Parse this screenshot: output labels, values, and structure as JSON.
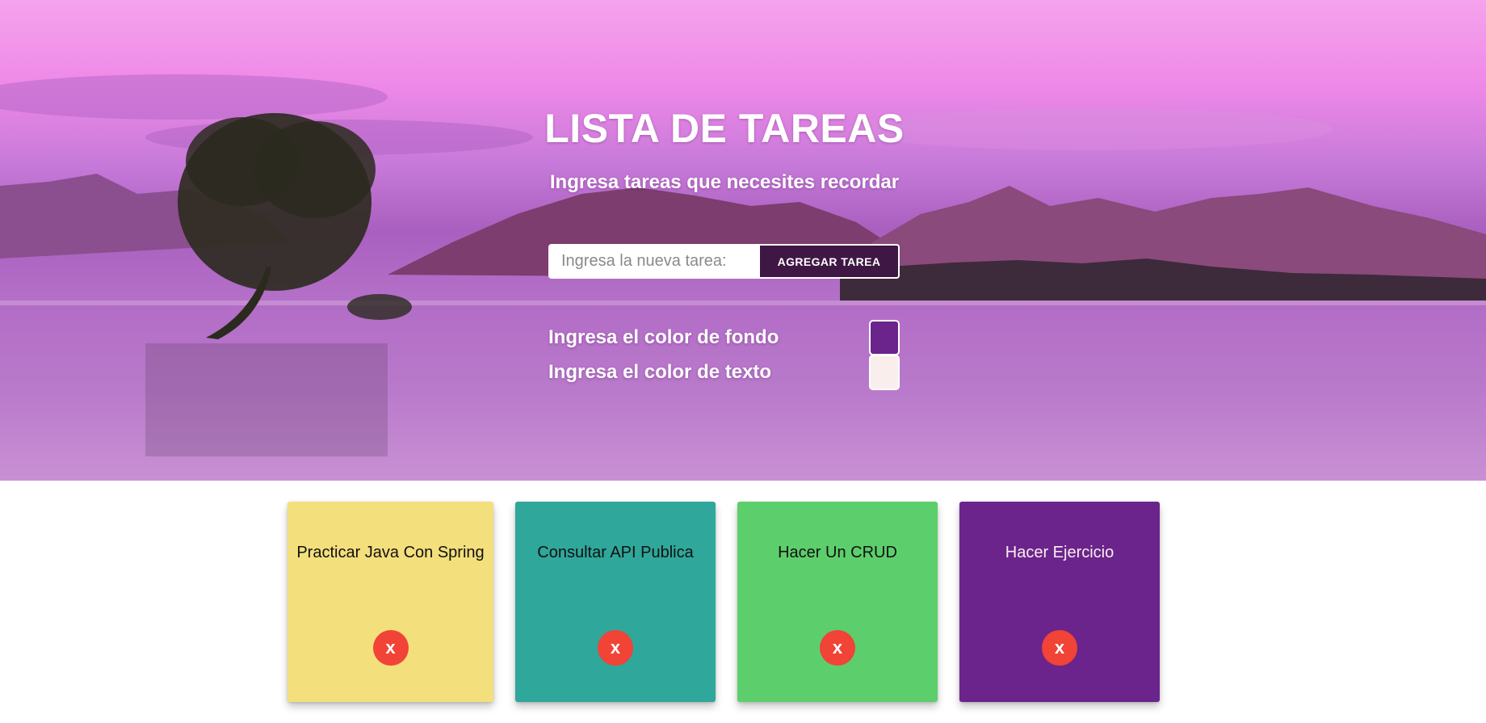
{
  "header": {
    "title": "LISTA DE TAREAS",
    "subtitle": "Ingresa tareas que necesites recordar"
  },
  "form": {
    "task_placeholder": "Ingresa la nueva tarea:",
    "task_value": "",
    "add_label": "AGREGAR TAREA"
  },
  "colors": {
    "background_label": "Ingresa el color de fondo",
    "background_value": "#6b248c",
    "text_label": "Ingresa el color de texto",
    "text_value": "#faeeec",
    "accent_button": "#3f1744",
    "delete_button": "#f14336"
  },
  "tasks": [
    {
      "title": "Practicar Java Con Spring",
      "background": "#f4df7d",
      "text_color": "#111111",
      "delete_label": "x"
    },
    {
      "title": "Consultar API Publica",
      "background": "#2fa79b",
      "text_color": "#111111",
      "delete_label": "x"
    },
    {
      "title": "Hacer Un CRUD",
      "background": "#5ccf6c",
      "text_color": "#111111",
      "delete_label": "x"
    },
    {
      "title": "Hacer Ejercicio",
      "background": "#6b248c",
      "text_color": "#faeeec",
      "delete_label": "x"
    }
  ]
}
